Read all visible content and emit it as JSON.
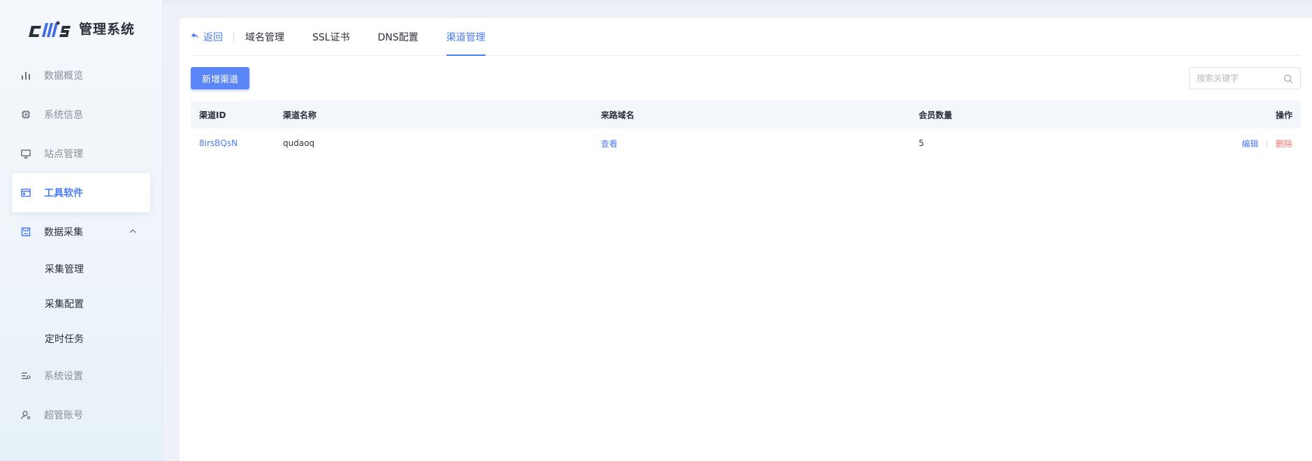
{
  "brand": {
    "logo_text": "管理系统",
    "accent": "#4a7cf6"
  },
  "sidebar": {
    "items": [
      {
        "label": "数据概览",
        "icon": "bar-chart-icon"
      },
      {
        "label": "系统信息",
        "icon": "chip-icon"
      },
      {
        "label": "站点管理",
        "icon": "monitor-icon"
      },
      {
        "label": "工具软件",
        "icon": "window-icon",
        "active": true
      },
      {
        "label": "数据采集",
        "icon": "save-icon",
        "open": true
      },
      {
        "label": "系统设置",
        "icon": "settings-sliders-icon"
      },
      {
        "label": "超管账号",
        "icon": "user-icon"
      }
    ],
    "sub_items": [
      "采集管理",
      "采集配置",
      "定时任务"
    ]
  },
  "tabs": {
    "back_label": "返回",
    "items": [
      "域名管理",
      "SSL证书",
      "DNS配置",
      "渠道管理"
    ],
    "active": "渠道管理"
  },
  "toolbar": {
    "add_label": "新增渠道",
    "search_placeholder": "搜索关键字"
  },
  "table": {
    "headers": {
      "id": "渠道ID",
      "name": "渠道名称",
      "domain": "来路域名",
      "members": "会员数量",
      "ops": "操作"
    },
    "rows": [
      {
        "id": "8irsBQsN",
        "name": "qudaoq",
        "domain_link": "查看",
        "members": "5",
        "edit": "编辑",
        "delete": "删除"
      }
    ]
  }
}
